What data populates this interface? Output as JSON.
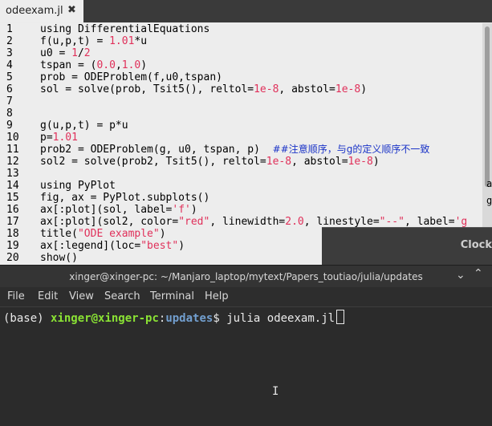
{
  "editor": {
    "tab": {
      "title": "odeexam.jl",
      "close": "✖"
    },
    "lines": [
      {
        "n": "1",
        "parts": [
          {
            "t": "using DifferentialEquations"
          }
        ]
      },
      {
        "n": "2",
        "parts": [
          {
            "t": "f(u,p,t) = "
          },
          {
            "t": "1.01",
            "c": "num"
          },
          {
            "t": "*u"
          }
        ]
      },
      {
        "n": "3",
        "parts": [
          {
            "t": "u0 = "
          },
          {
            "t": "1",
            "c": "num"
          },
          {
            "t": "/"
          },
          {
            "t": "2",
            "c": "num"
          }
        ]
      },
      {
        "n": "4",
        "parts": [
          {
            "t": "tspan = ("
          },
          {
            "t": "0.0",
            "c": "num"
          },
          {
            "t": ","
          },
          {
            "t": "1.0",
            "c": "num"
          },
          {
            "t": ")"
          }
        ]
      },
      {
        "n": "5",
        "parts": [
          {
            "t": "prob = ODEProblem(f,u0,tspan)"
          }
        ]
      },
      {
        "n": "6",
        "parts": [
          {
            "t": "sol = solve(prob, Tsit5(), reltol="
          },
          {
            "t": "1e-8",
            "c": "num"
          },
          {
            "t": ", abstol="
          },
          {
            "t": "1e-8",
            "c": "num"
          },
          {
            "t": ")"
          }
        ]
      },
      {
        "n": "7",
        "parts": []
      },
      {
        "n": "8",
        "parts": []
      },
      {
        "n": "9",
        "parts": [
          {
            "t": "g(u,p,t) = p*u"
          }
        ]
      },
      {
        "n": "10",
        "parts": [
          {
            "t": "p="
          },
          {
            "t": "1.01",
            "c": "num"
          }
        ]
      },
      {
        "n": "11",
        "parts": [
          {
            "t": "prob2 = ODEProblem(g, u0, tspan, p)  "
          },
          {
            "t": "##注意顺序，与g的定义顺序不一致",
            "c": "cmt"
          }
        ]
      },
      {
        "n": "12",
        "parts": [
          {
            "t": "sol2 = solve(prob2, Tsit5(), reltol="
          },
          {
            "t": "1e-8",
            "c": "num"
          },
          {
            "t": ", abstol="
          },
          {
            "t": "1e-8",
            "c": "num"
          },
          {
            "t": ")"
          }
        ]
      },
      {
        "n": "13",
        "parts": []
      },
      {
        "n": "14",
        "parts": [
          {
            "t": "using PyPlot"
          }
        ]
      },
      {
        "n": "15",
        "parts": [
          {
            "t": "fig, ax = PyPlot.subplots()"
          }
        ]
      },
      {
        "n": "16",
        "parts": [
          {
            "t": "ax[:plot](sol, label="
          },
          {
            "t": "'f'",
            "c": "str"
          },
          {
            "t": ")"
          }
        ]
      },
      {
        "n": "17",
        "parts": [
          {
            "t": "ax[:plot](sol2, color="
          },
          {
            "t": "\"red\"",
            "c": "str"
          },
          {
            "t": ", linewidth="
          },
          {
            "t": "2.0",
            "c": "num"
          },
          {
            "t": ", linestyle="
          },
          {
            "t": "\"--\"",
            "c": "str"
          },
          {
            "t": ", label="
          },
          {
            "t": "'g",
            "c": "str"
          }
        ]
      },
      {
        "n": "18",
        "parts": [
          {
            "t": "title("
          },
          {
            "t": "\"ODE example\"",
            "c": "str"
          },
          {
            "t": ")"
          }
        ]
      },
      {
        "n": "19",
        "parts": [
          {
            "t": "ax[:legend](loc="
          },
          {
            "t": "\"best\"",
            "c": "str"
          },
          {
            "t": ")"
          }
        ]
      },
      {
        "n": "20",
        "parts": [
          {
            "t": "show()"
          }
        ]
      }
    ],
    "edge_a": "a",
    "edge_g": "g"
  },
  "clock_window": {
    "title": "Clock"
  },
  "terminal": {
    "title": "xinger@xinger-pc: ~/Manjaro_laptop/mytext/Papers_toutiao/julia/updates",
    "min_icon": "⌄",
    "max_icon": "⌃",
    "menu": [
      "File",
      "Edit",
      "View",
      "Search",
      "Terminal",
      "Help"
    ],
    "prompt": {
      "env": "(base) ",
      "user": "xinger@xinger-pc",
      "sep": ":",
      "path": "updates",
      "dollar": "$ ",
      "command": "julia odeexam.jl"
    },
    "ibeam": "I"
  },
  "colors": {
    "comment": "#1a33c7",
    "number": "#e0305a",
    "user": "#8ae234",
    "path": "#729fcf"
  }
}
